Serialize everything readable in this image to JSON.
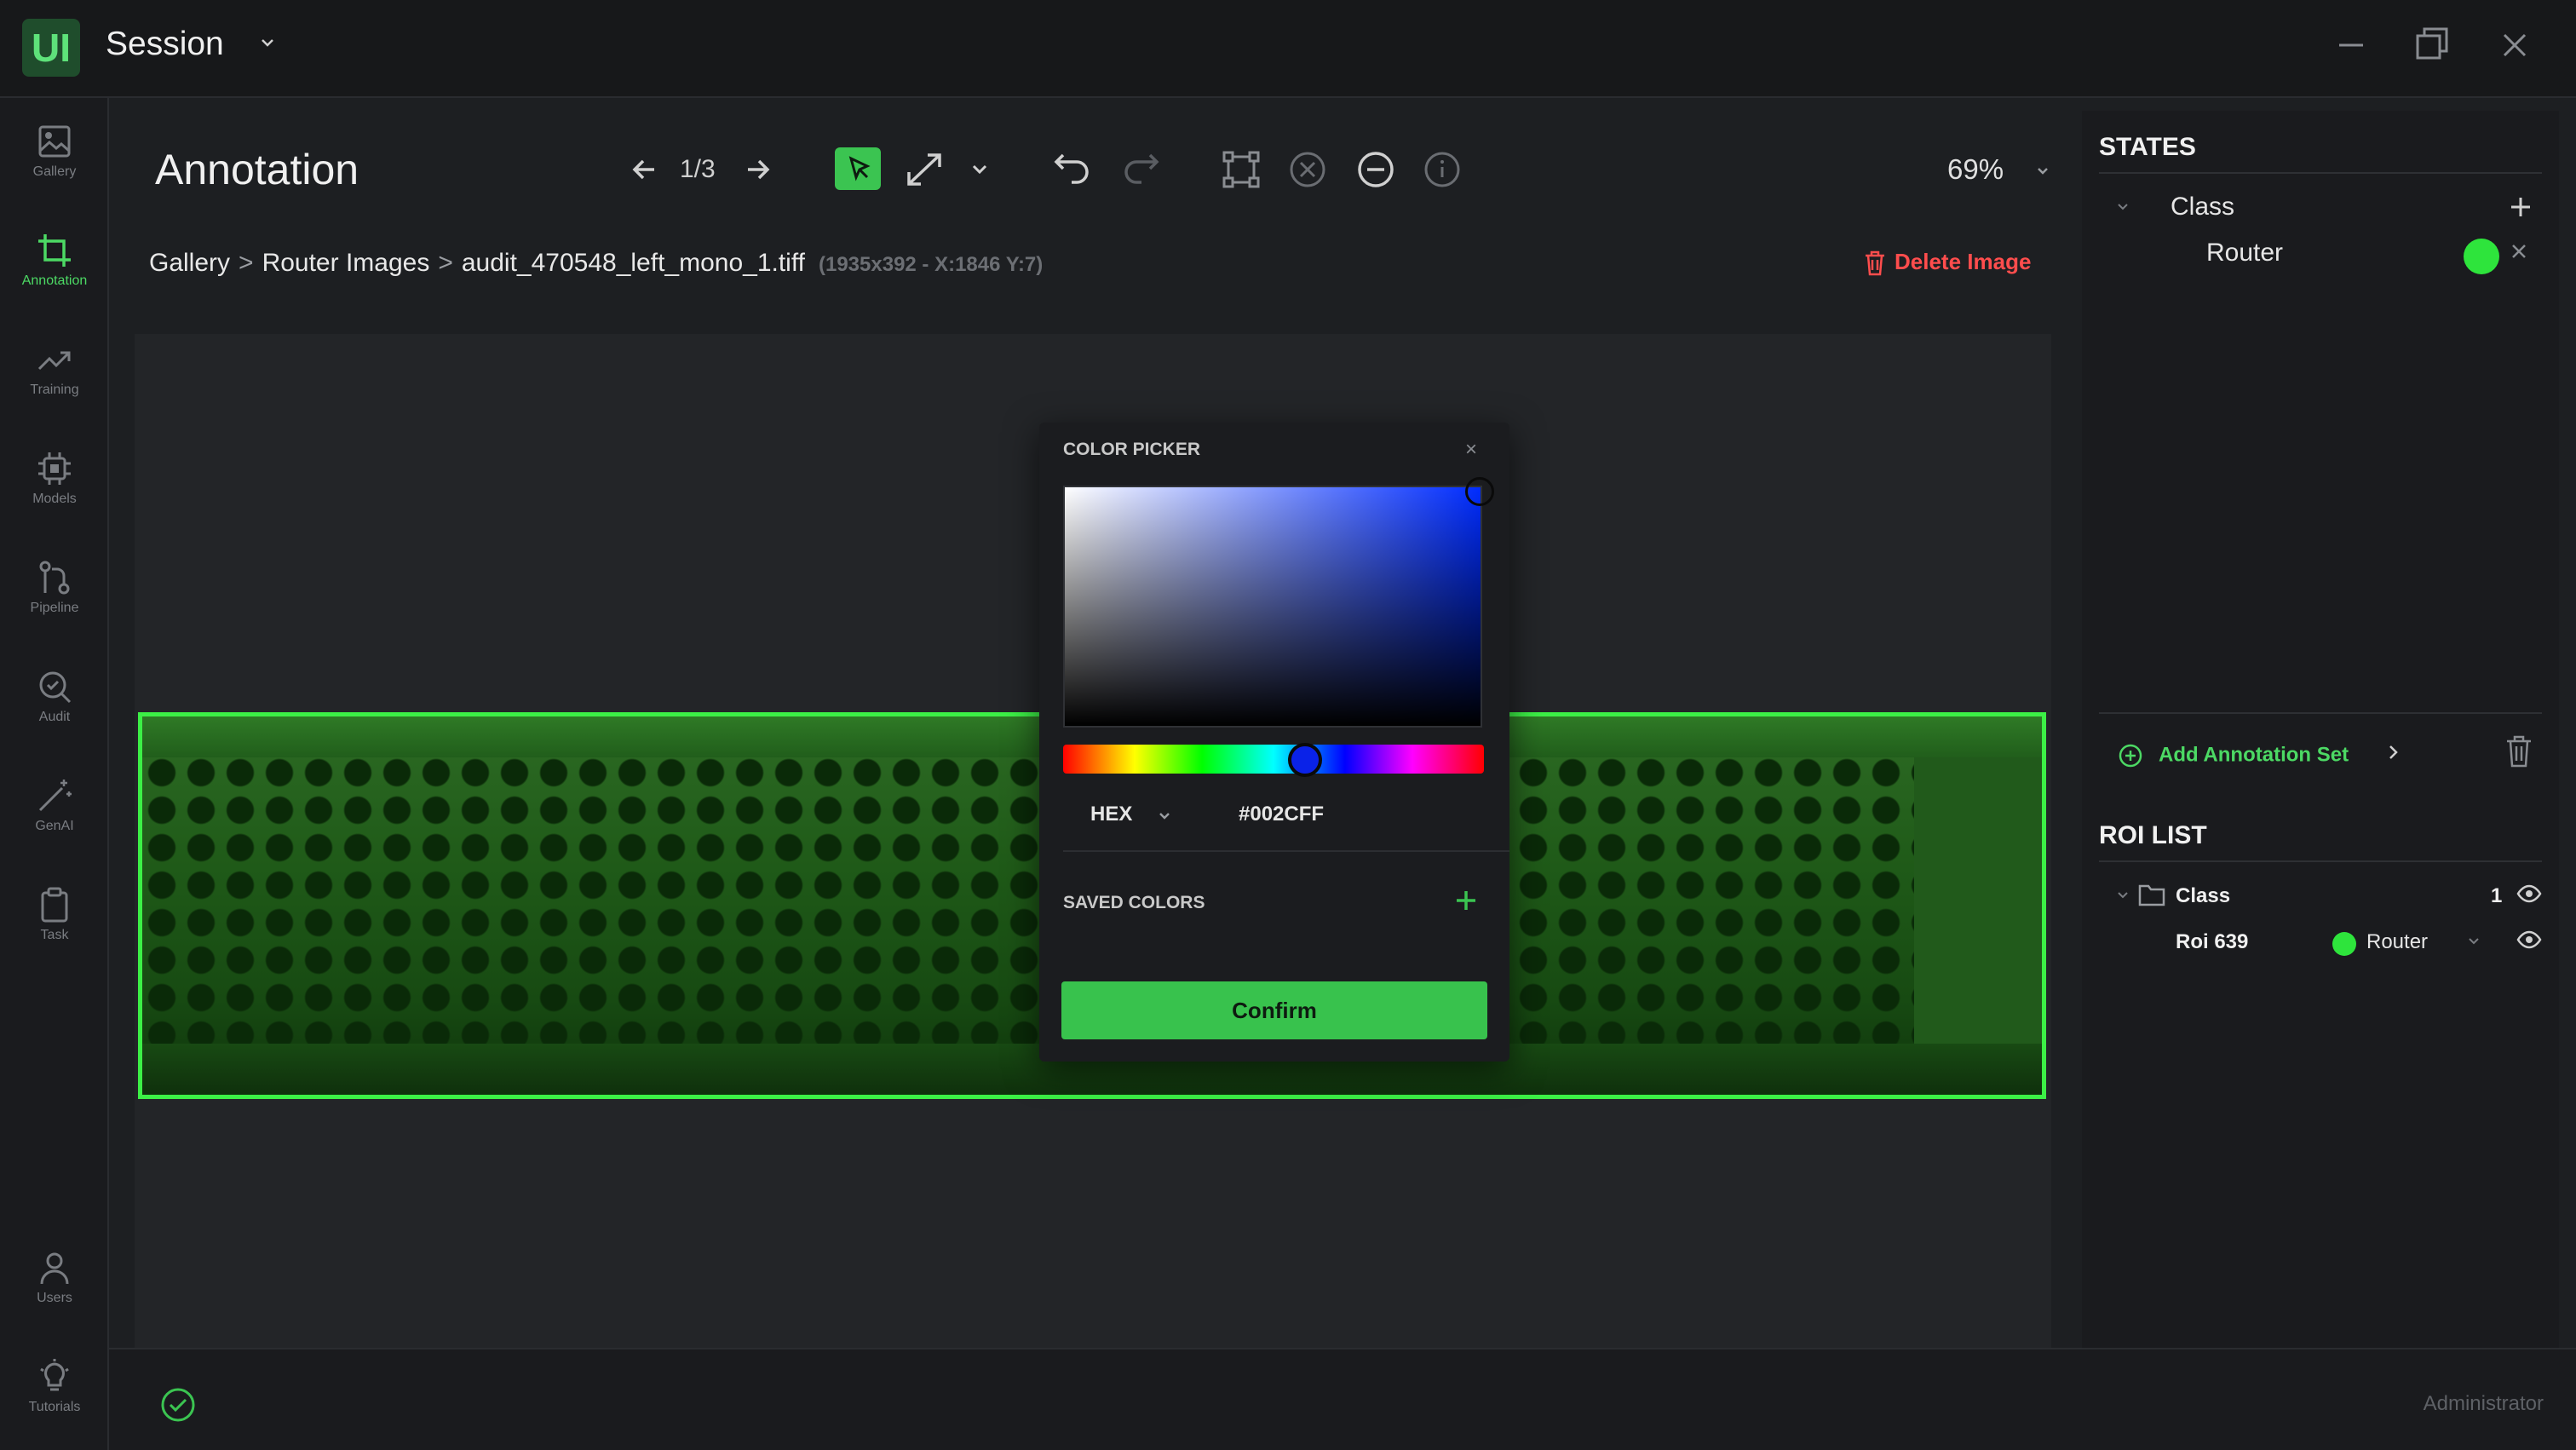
{
  "app": {
    "logo_text": "UI",
    "session_title": "Session"
  },
  "nav": {
    "items": [
      {
        "label": "Gallery",
        "icon": "image-icon"
      },
      {
        "label": "Annotation",
        "icon": "crop-icon",
        "active": true
      },
      {
        "label": "Training",
        "icon": "trend-icon"
      },
      {
        "label": "Models",
        "icon": "chip-icon"
      },
      {
        "label": "Pipeline",
        "icon": "branch-icon"
      },
      {
        "label": "Audit",
        "icon": "search-icon"
      },
      {
        "label": "GenAI",
        "icon": "wand-icon"
      },
      {
        "label": "Task",
        "icon": "clipboard-icon"
      }
    ],
    "bottom_items": [
      {
        "label": "Users",
        "icon": "user-icon"
      },
      {
        "label": "Tutorials",
        "icon": "lightbulb-icon"
      }
    ]
  },
  "toolbar": {
    "title": "Annotation",
    "page_indicator": "1/3",
    "zoom": "69%"
  },
  "breadcrumb": {
    "items": [
      "Gallery",
      "Router Images",
      "audit_470548_left_mono_1.tiff"
    ],
    "separator": ">",
    "meta": "(1935x392 - X:1846 Y:7)"
  },
  "delete_image_label": "Delete Image",
  "color_picker": {
    "title": "COLOR PICKER",
    "close": "×",
    "format": "HEX",
    "value": "#002CFF",
    "saved_colors_title": "SAVED COLORS",
    "confirm_label": "Confirm"
  },
  "states": {
    "title": "STATES",
    "class_label": "Class",
    "router_label": "Router",
    "router_color": "#2ee43c",
    "add_annotation_set_label": "Add Annotation Set"
  },
  "roi_list": {
    "title": "ROI LIST",
    "class_label": "Class",
    "count": "1",
    "roi_name": "Roi 639",
    "roi_class": "Router"
  },
  "footer": {
    "user_role": "Administrator"
  },
  "colors": {
    "accent": "#3bc451",
    "danger": "#ff4d4d",
    "roi_outline": "#3cf046"
  }
}
